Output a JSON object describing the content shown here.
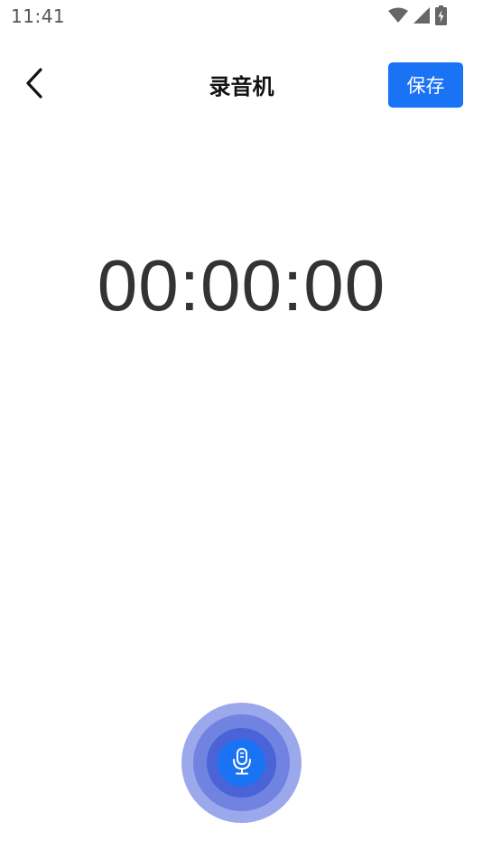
{
  "status_bar": {
    "time": "11:41",
    "icons": [
      "wifi-icon",
      "cellular-signal-icon",
      "battery-charging-icon"
    ]
  },
  "header": {
    "back_icon": "chevron-left-icon",
    "title": "录音机",
    "save_label": "保存"
  },
  "timer": {
    "value": "00:00:00"
  },
  "record": {
    "icon": "microphone-icon"
  },
  "colors": {
    "accent": "#1a73f5",
    "ring_outer": "#9ba8ec",
    "ring_middle": "#7083e0",
    "ring_inner": "#4a63d6"
  }
}
